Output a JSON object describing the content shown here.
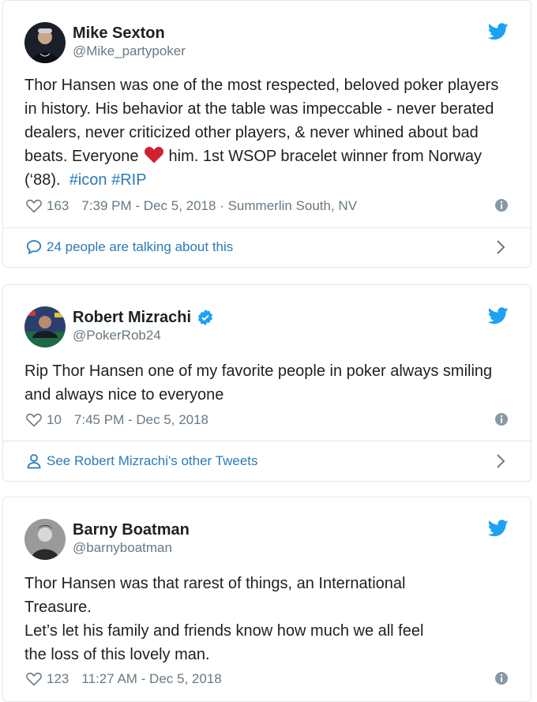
{
  "colors": {
    "link": "#2b7bb9",
    "muted": "#697882",
    "heart": "#e0245e",
    "twitter": "#1da1f2",
    "verified": "#1da1f2"
  },
  "tweets": [
    {
      "name": "Mike Sexton",
      "handle": "@Mike_partypoker",
      "text_1": "Thor Hansen was one of the most respected, beloved poker players in history. His behavior at the table was impeccable - never berated dealers, never criticized other players, & never whined about bad beats. Everyone",
      "text_2": "him. 1st WSOP bracelet winner from Norway (‘88).",
      "hashtags": [
        "#icon",
        "#RIP"
      ],
      "likes": "163",
      "timestamp": "7:39 PM - Dec 5, 2018",
      "location": "· Summerlin South, NV",
      "footer": "24 people are talking about this",
      "footer_icon": "speech-bubble-icon"
    },
    {
      "name": "Robert Mizrachi",
      "handle": "@PokerRob24",
      "verified": true,
      "text": "Rip Thor Hansen one of my favorite people in poker always smiling and always nice to everyone",
      "likes": "10",
      "timestamp": "7:45 PM - Dec 5, 2018",
      "footer": "See Robert Mizrachi's other Tweets",
      "footer_icon": "person-icon"
    },
    {
      "name": "Barny Boatman",
      "handle": "@barnyboatman",
      "text_1": "Thor Hansen was that rarest of things, an International Treasure.",
      "text_2": "Let’s let his family and friends know how much we all feel the loss of this lovely man.",
      "likes": "123",
      "timestamp": "11:27 AM - Dec 5, 2018"
    }
  ]
}
